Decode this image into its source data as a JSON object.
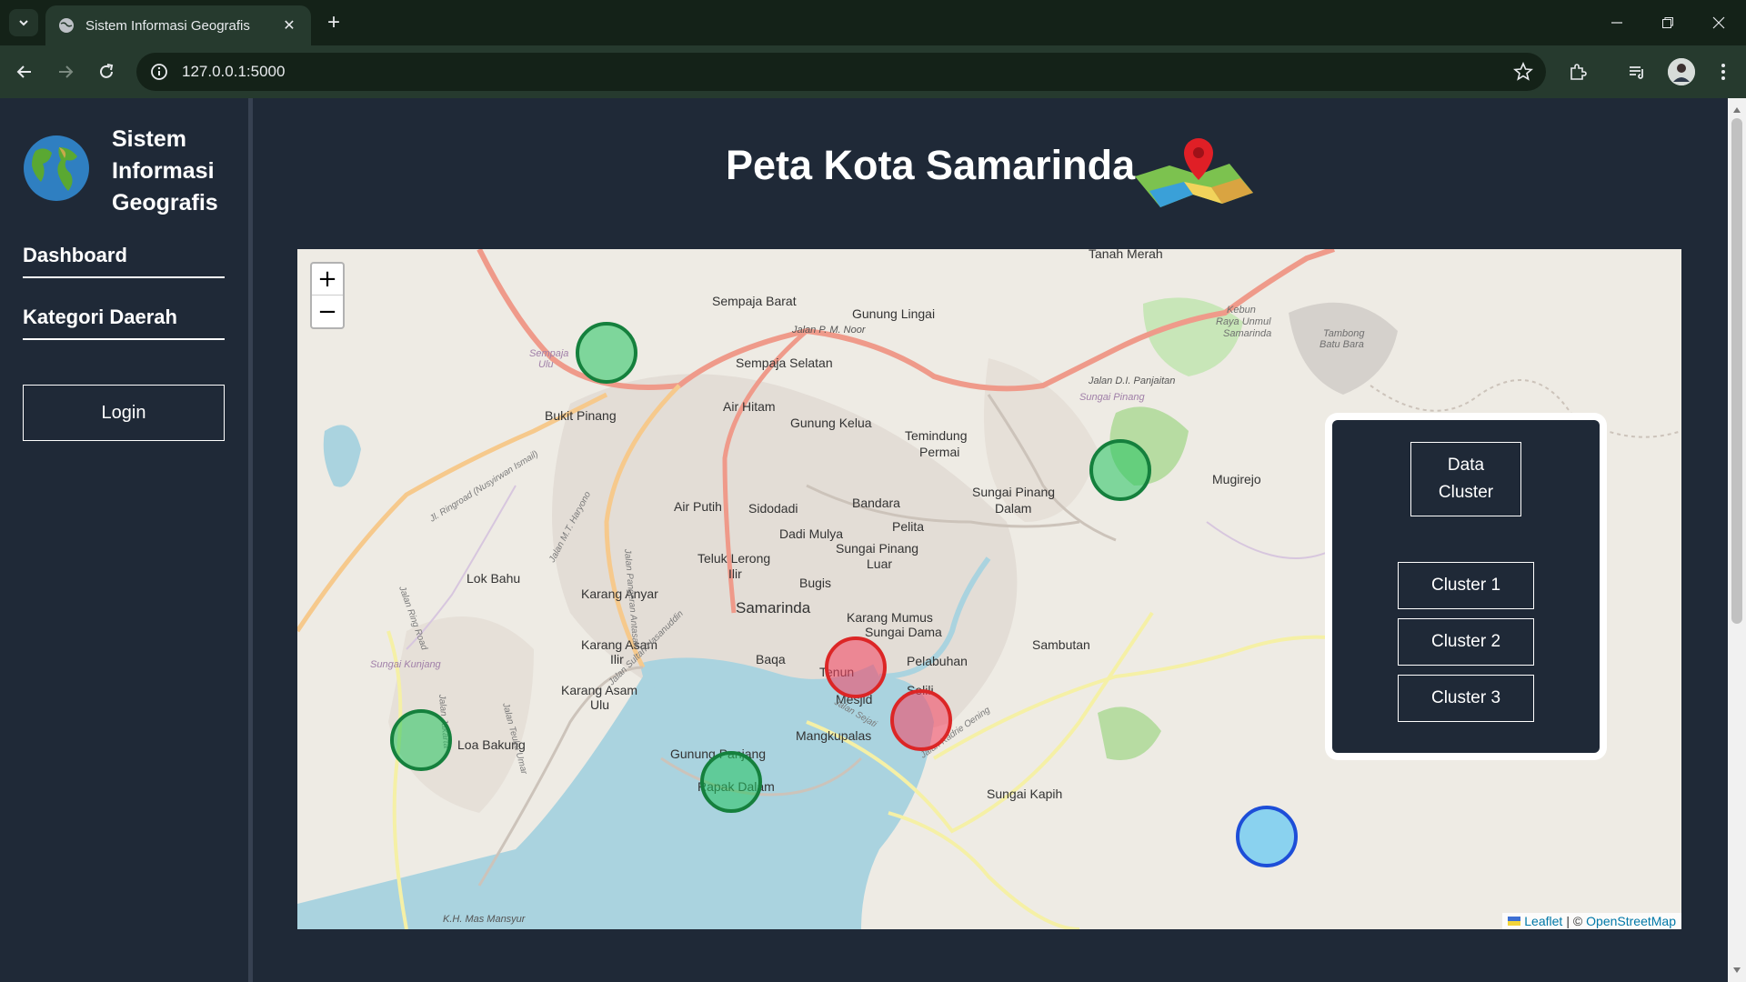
{
  "browser": {
    "tab_title": "Sistem Informasi Geografis",
    "url": "127.0.0.1:5000"
  },
  "sidebar": {
    "brand_lines": [
      "Sistem",
      "Informasi",
      "Geografis"
    ],
    "nav": [
      {
        "label": "Dashboard"
      },
      {
        "label": "Kategori Daerah"
      }
    ],
    "login_label": "Login"
  },
  "main": {
    "title": "Peta Kota Samarinda"
  },
  "map": {
    "zoom_in": "+",
    "zoom_out": "−",
    "attribution": {
      "leaflet": "Leaflet",
      "separator": "| ©",
      "osm": "OpenStreetMap"
    },
    "place_labels": [
      "Tanah Merah",
      "Sempaja Barat",
      "Gunung Lingai",
      "Sempaja Selatan",
      "Sempaja Utara",
      "Kebun Raya Unmul Samarinda",
      "Tambong Batu Bara",
      "Bukit Pinang",
      "Air Hitam",
      "Gunung Kelua",
      "Temindung Permai",
      "Sungai Pinang",
      "Mugirejo",
      "Sungai Pinang Dalam",
      "Air Putih",
      "Sidodadi",
      "Bandara",
      "Pelita",
      "Dadi Mulya",
      "Sungai Pinang Luar",
      "Teluk Lerong Ilir",
      "Lok Bahu",
      "Karang Anyar",
      "Bugis",
      "Samarinda",
      "Karang Mumus",
      "Sungai Dama",
      "Sambutan",
      "Karang Asam Ilir",
      "Baqa",
      "Tenun",
      "Pelabuhan",
      "Selili",
      "Karang Asam Ulu",
      "Mesjid",
      "Sungai Kunjang",
      "Loa Bakung",
      "Mangkupalas",
      "Gunung Panjang",
      "Rapak Dalam",
      "Sungai Kapih",
      "Sempaja Ulu",
      "Jalan P. M. Noor",
      "Jalan D.I. Panjaitan",
      "Jl. Ringroad (Nusyirwan Ismail)",
      "Jalan Ring Road",
      "Jalan Jakarta",
      "Jalan Teuku Umar",
      "K.H. Mas Mansyur",
      "Jalan Sultan Hasanuddin",
      "Jalan Sejati",
      "Jalan Kadrie Oening",
      "Jalan Pangeran Antasari",
      "Jalan M.T. Haryono"
    ],
    "markers": [
      {
        "cluster": "green",
        "color": "#22c55e",
        "stroke": "#15803d"
      },
      {
        "cluster": "green",
        "color": "#22c55e",
        "stroke": "#15803d"
      },
      {
        "cluster": "green",
        "color": "#22c55e",
        "stroke": "#15803d"
      },
      {
        "cluster": "green",
        "color": "#22c55e",
        "stroke": "#15803d"
      },
      {
        "cluster": "red",
        "color": "#f43f5e",
        "stroke": "#dc2626"
      },
      {
        "cluster": "red",
        "color": "#f43f5e",
        "stroke": "#dc2626"
      },
      {
        "cluster": "blue",
        "color": "#38bdf8",
        "stroke": "#1d4ed8"
      }
    ]
  },
  "panel": {
    "data_cluster_lines": [
      "Data",
      "Cluster"
    ],
    "clusters": [
      {
        "label": "Cluster 1"
      },
      {
        "label": "Cluster 2"
      },
      {
        "label": "Cluster 3"
      }
    ]
  },
  "colors": {
    "page_bg": "#1f2937",
    "chrome_bg": "#142218",
    "toolbar_bg": "#263a2e"
  }
}
